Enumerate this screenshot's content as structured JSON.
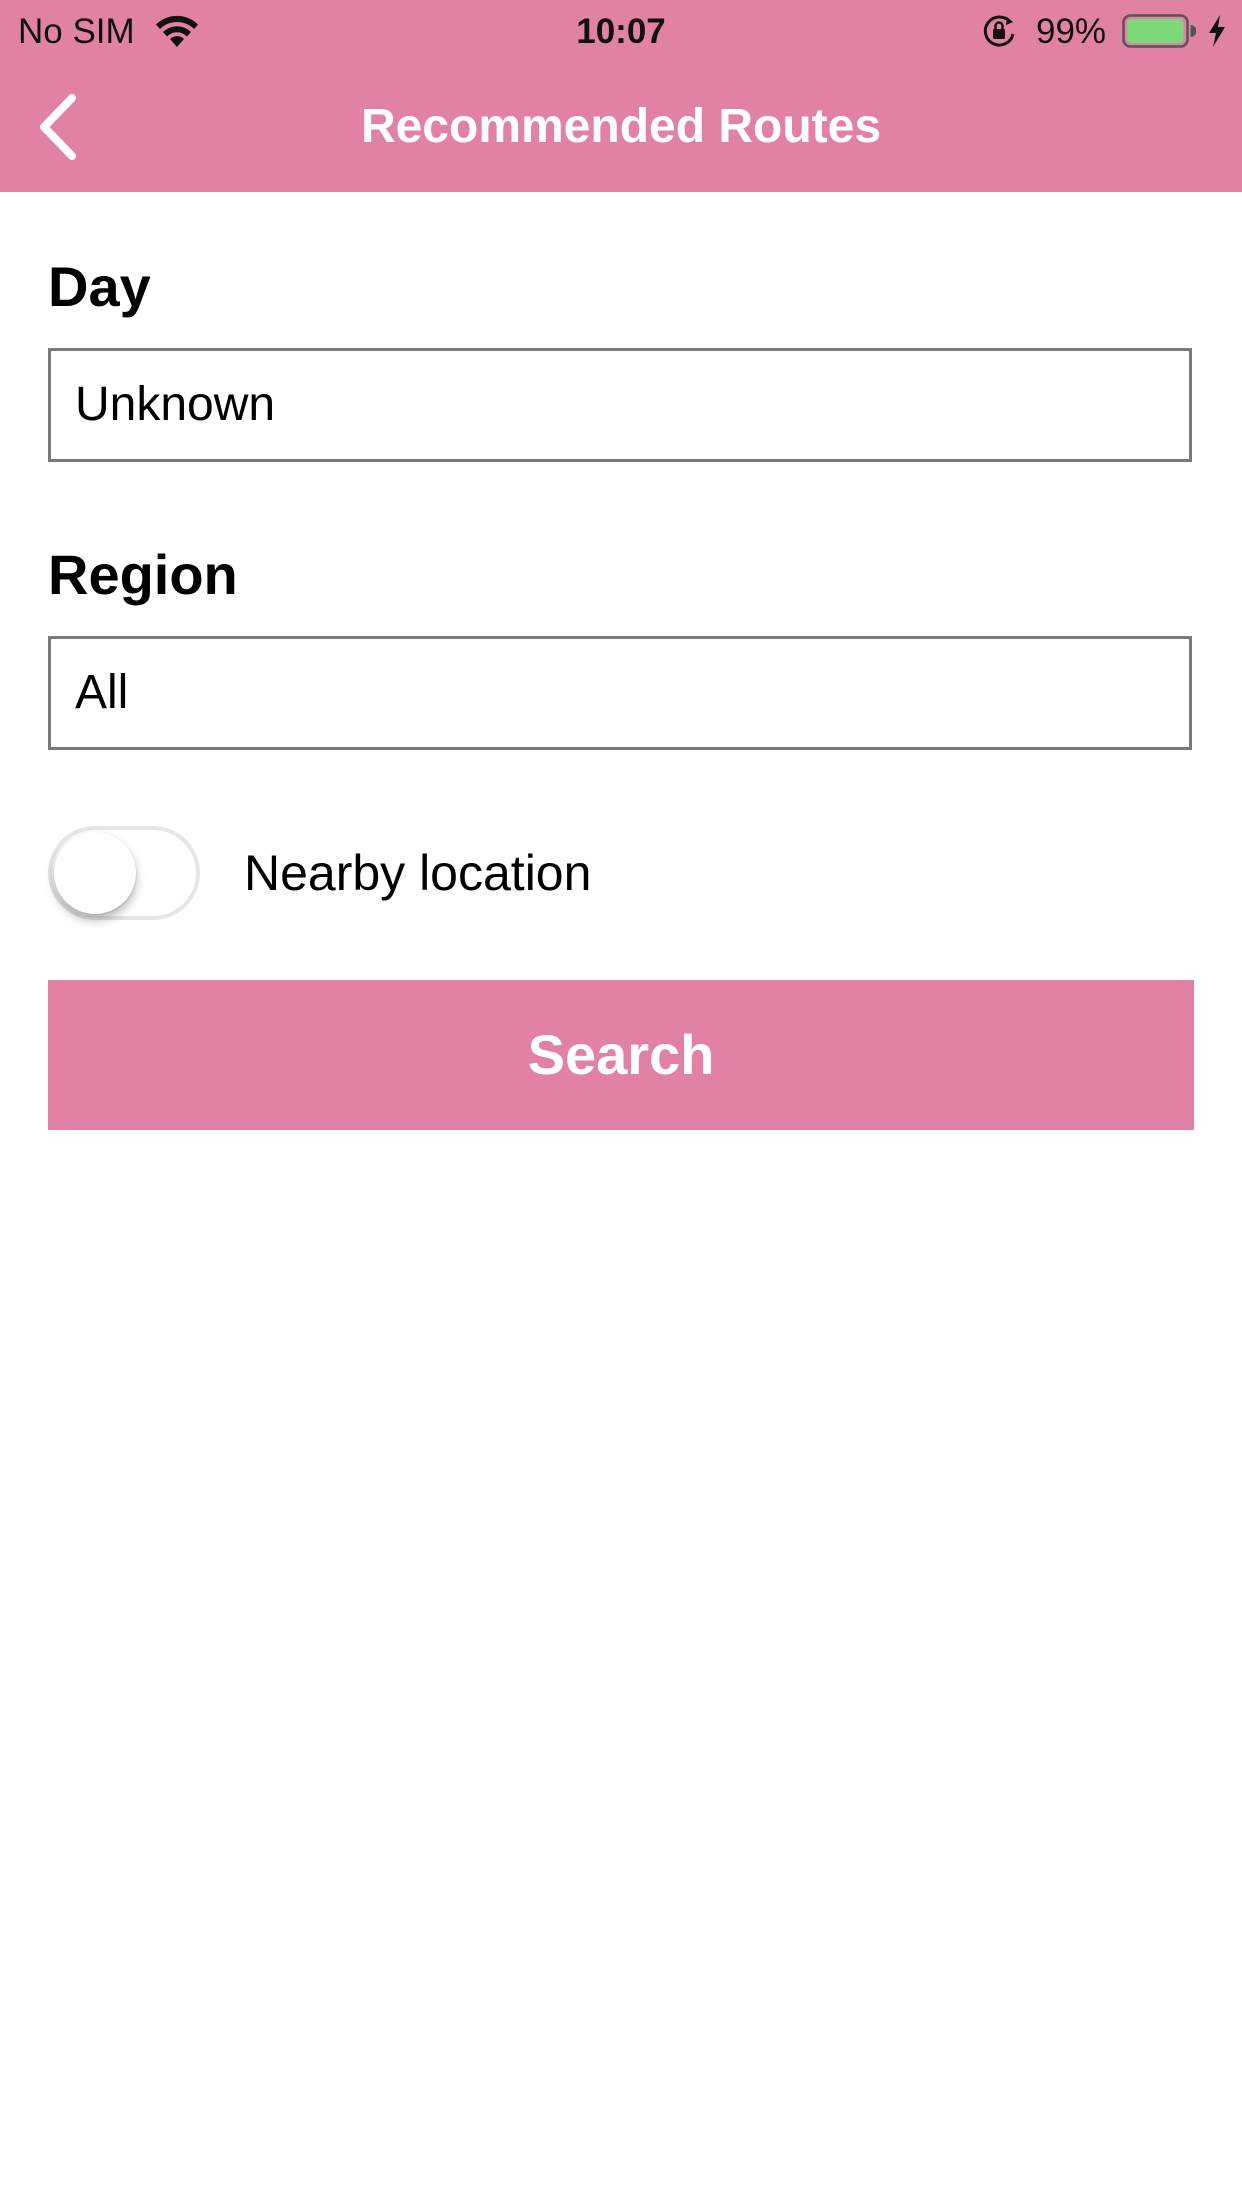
{
  "status_bar": {
    "carrier": "No SIM",
    "time": "10:07",
    "battery_percent": "99%",
    "battery_level": 0.99,
    "icons": [
      "wifi-icon",
      "orientation-lock-icon",
      "battery-icon",
      "charging-bolt-icon"
    ]
  },
  "nav": {
    "title": "Recommended Routes",
    "back_icon": "chevron-left-icon"
  },
  "form": {
    "day_label": "Day",
    "day_value": "Unknown",
    "region_label": "Region",
    "region_value": "All",
    "nearby_label": "Nearby location",
    "nearby_enabled": false,
    "search_label": "Search"
  },
  "colors": {
    "accent": "#e281a6",
    "battery_fill": "#7dd87a"
  }
}
